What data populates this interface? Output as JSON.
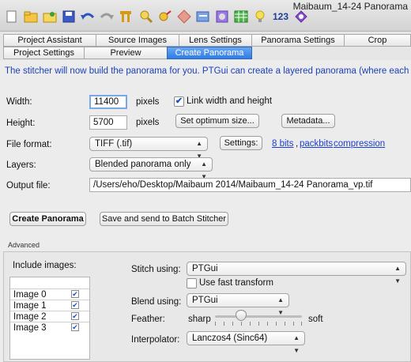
{
  "window": {
    "title": "Maibaum_14-24 Panorama"
  },
  "toolbar": {
    "icons": [
      "new-document-icon",
      "open-folder-icon",
      "open-project-icon",
      "save-icon",
      "undo-icon",
      "redo-icon",
      "align-images-icon",
      "zoom-icon",
      "control-points-icon",
      "mask-icon",
      "panorama-editor-icon",
      "table-icon",
      "tip-bulb-icon",
      "numbers-icon",
      "batch-icon"
    ],
    "numbers_label": "123"
  },
  "tabs": {
    "row1": [
      "Project Assistant",
      "Source Images",
      "Lens Settings",
      "Panorama Settings",
      "Crop"
    ],
    "row2": [
      "Project Settings",
      "Preview",
      "Create Panorama"
    ],
    "selected": "Create Panorama"
  },
  "intro": "The stitcher will now build the panorama for you. PTGui can create a layered panorama (where each source",
  "form": {
    "width_label": "Width:",
    "width_value": "11400",
    "width_unit": "pixels",
    "link_label": "Link width and height",
    "link_checked": "✔",
    "height_label": "Height:",
    "height_value": "5700",
    "height_unit": "pixels",
    "optimum_button": "Set optimum size...",
    "metadata_button": "Metadata...",
    "format_label": "File format:",
    "format_value": "TIFF (.tif)",
    "settings_button": "Settings:",
    "format_link1": "8 bits",
    "format_sep": ",",
    "format_link2": "packbits",
    "format_link3": "compression",
    "layers_label": "Layers:",
    "layers_value": "Blended panorama only",
    "output_label": "Output file:",
    "output_value": "/Users/eho/Desktop/Maibaum 2014/Maibaum_14-24 Panorama_vp.tif",
    "create_button": "Create Panorama",
    "batch_button": "Save and send to Batch Stitcher"
  },
  "advanced": {
    "title": "Advanced",
    "include_label": "Include images:",
    "images": [
      {
        "name": "Image 0",
        "checked": "✔"
      },
      {
        "name": "Image 1",
        "checked": "✔"
      },
      {
        "name": "Image 2",
        "checked": "✔"
      },
      {
        "name": "Image 3",
        "checked": "✔"
      }
    ],
    "stitch_label": "Stitch using:",
    "stitch_value": "PTGui",
    "fast_transform_label": "Use fast transform",
    "blend_label": "Blend using:",
    "blend_value": "PTGui",
    "feather_label": "Feather:",
    "feather_min": "sharp",
    "feather_max": "soft",
    "feather_level": 0.3,
    "interpolator_label": "Interpolator:",
    "interpolator_value": "Lanczos4 (Sinc64)"
  }
}
